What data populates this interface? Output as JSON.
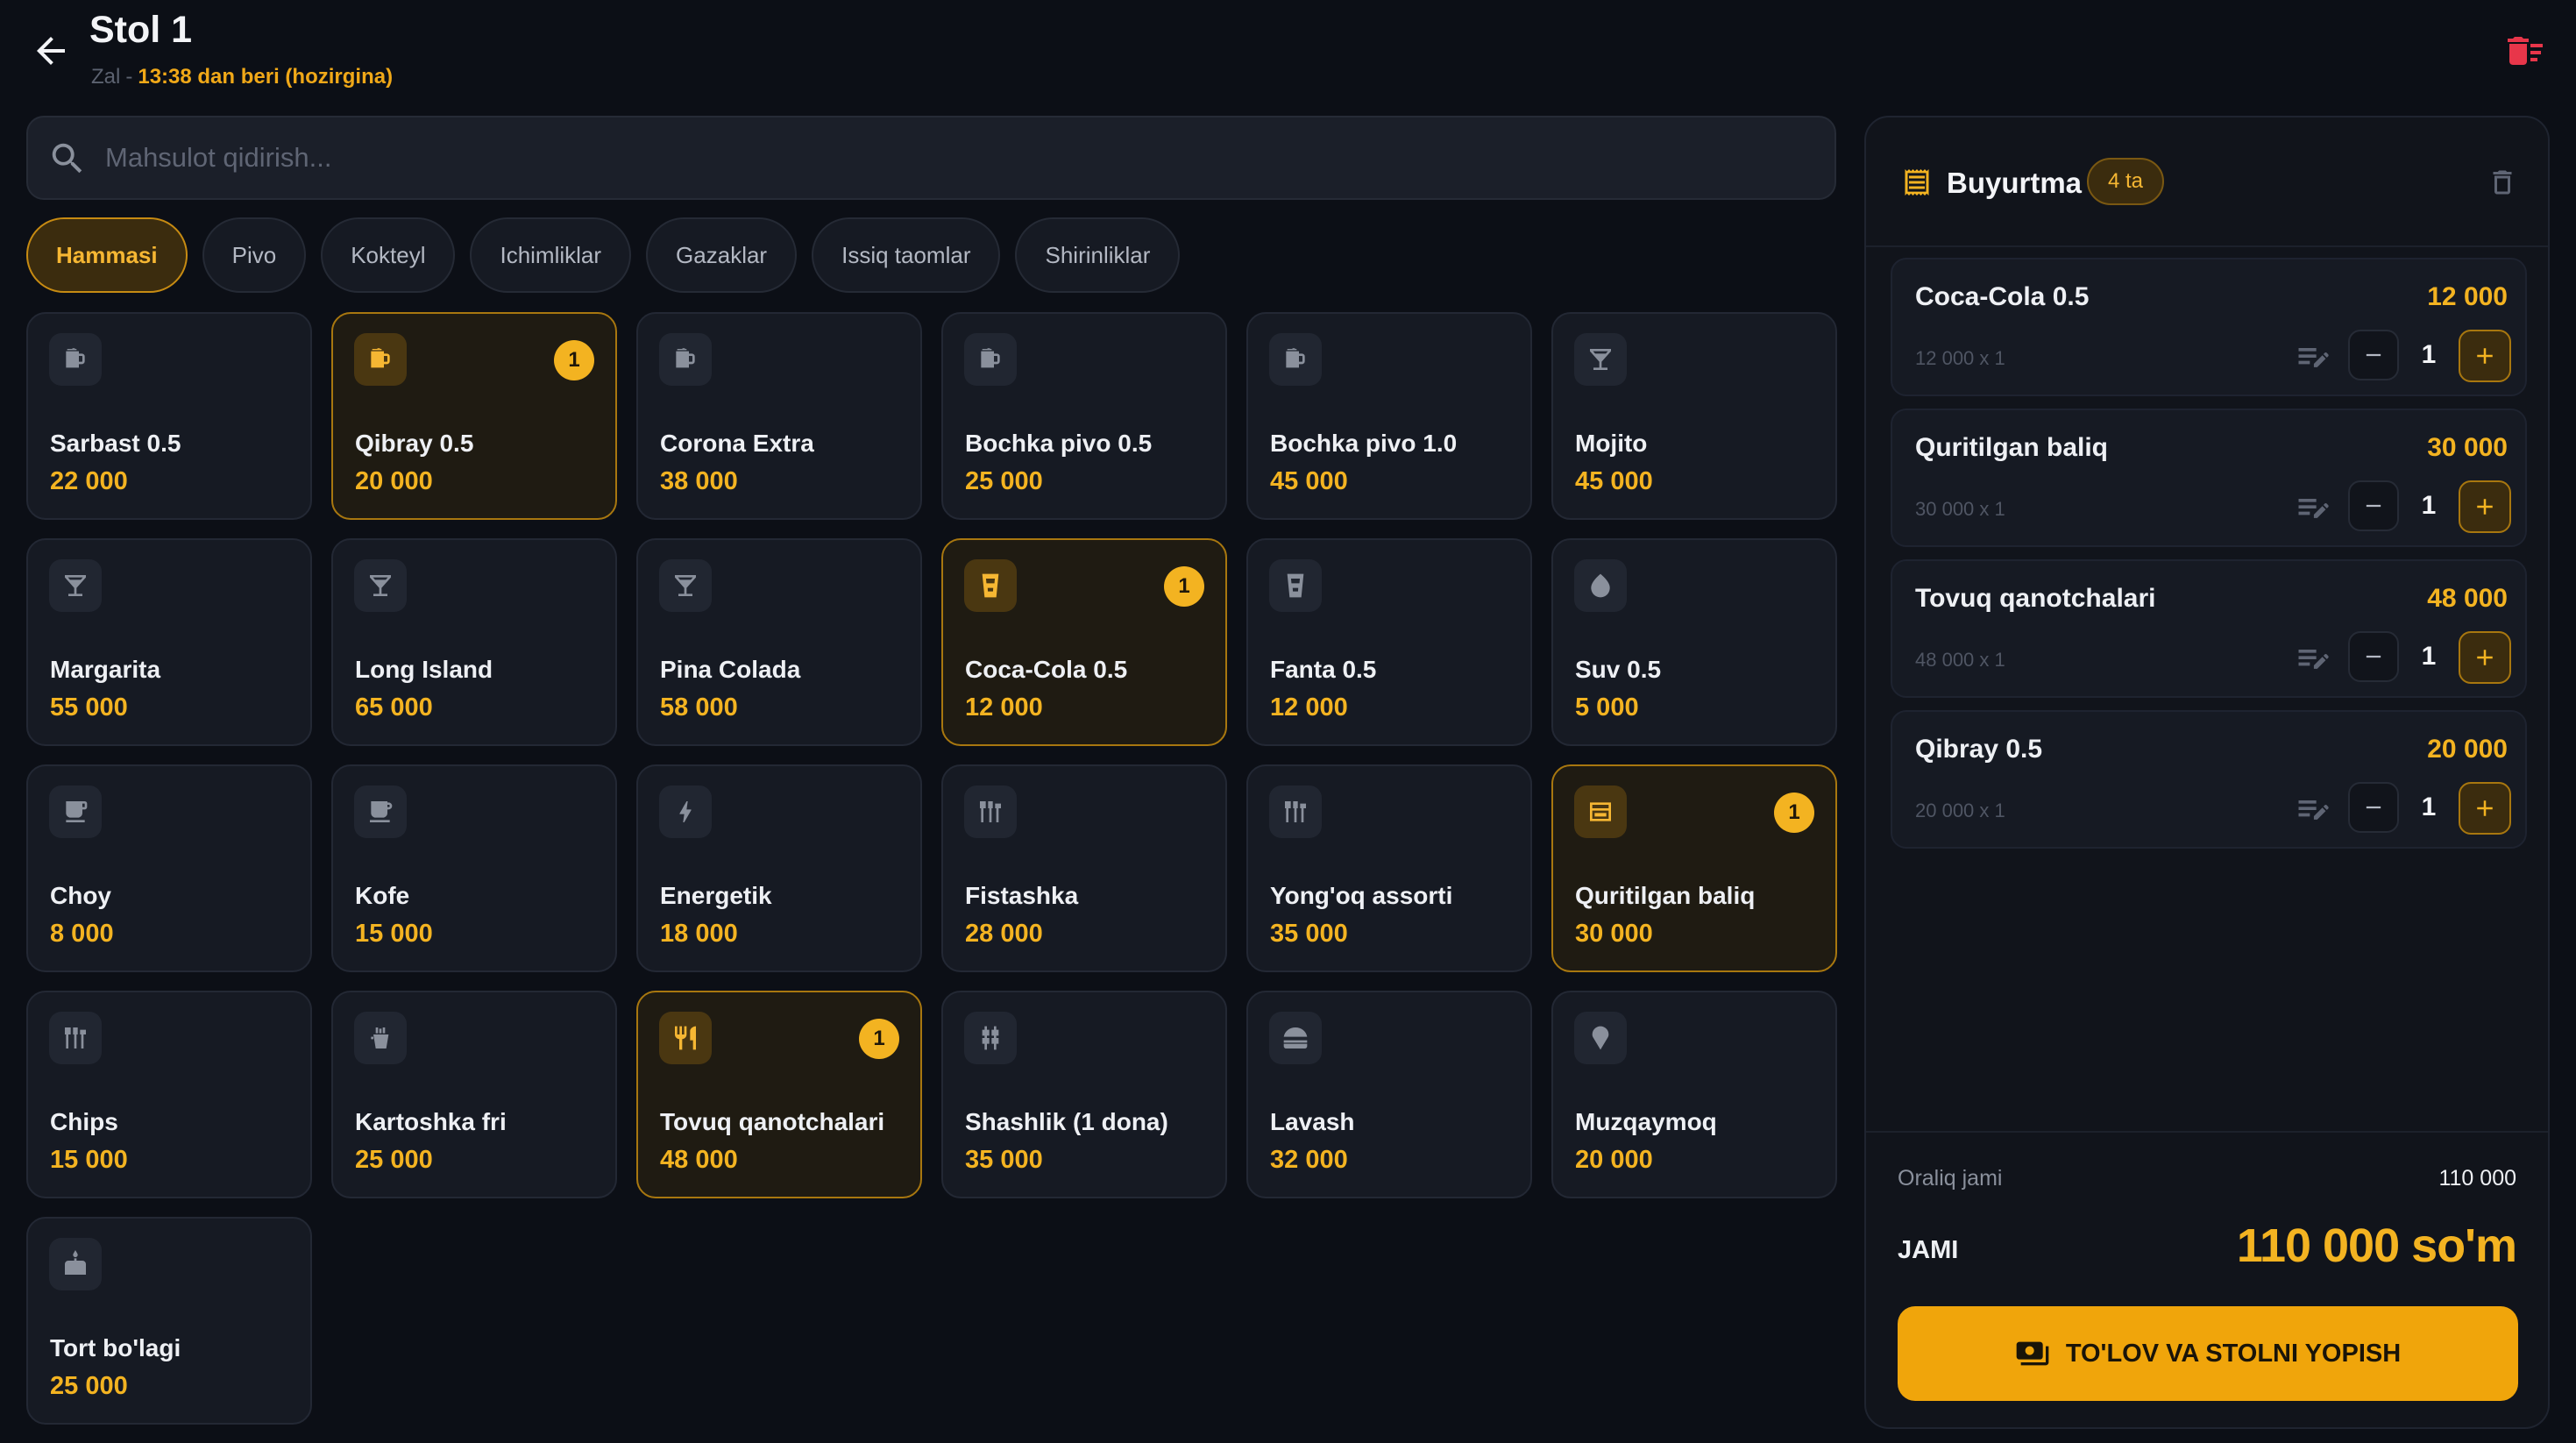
{
  "header": {
    "title": "Stol 1",
    "zone": "Zal",
    "separator": "-",
    "since": "13:38 dan beri (hozirgina)"
  },
  "search": {
    "placeholder": "Mahsulot qidirish..."
  },
  "categories": [
    {
      "label": "Hammasi",
      "active": true
    },
    {
      "label": "Pivo",
      "active": false
    },
    {
      "label": "Kokteyl",
      "active": false
    },
    {
      "label": "Ichimliklar",
      "active": false
    },
    {
      "label": "Gazaklar",
      "active": false
    },
    {
      "label": "Issiq taomlar",
      "active": false
    },
    {
      "label": "Shirinliklar",
      "active": false
    }
  ],
  "products": [
    {
      "name": "Sarbast 0.5",
      "price": "22 000",
      "icon": "beer-icon",
      "qty": ""
    },
    {
      "name": "Qibray 0.5",
      "price": "20 000",
      "icon": "beer-icon",
      "qty": "1"
    },
    {
      "name": "Corona Extra",
      "price": "38 000",
      "icon": "beer-icon",
      "qty": ""
    },
    {
      "name": "Bochka pivo 0.5",
      "price": "25 000",
      "icon": "beer-icon",
      "qty": ""
    },
    {
      "name": "Bochka pivo 1.0",
      "price": "45 000",
      "icon": "beer-icon",
      "qty": ""
    },
    {
      "name": "Mojito",
      "price": "45 000",
      "icon": "cocktail-icon",
      "qty": ""
    },
    {
      "name": "Margarita",
      "price": "55 000",
      "icon": "cocktail-icon",
      "qty": ""
    },
    {
      "name": "Long Island",
      "price": "65 000",
      "icon": "cocktail-icon",
      "qty": ""
    },
    {
      "name": "Pina Colada",
      "price": "58 000",
      "icon": "cocktail-icon",
      "qty": ""
    },
    {
      "name": "Coca-Cola 0.5",
      "price": "12 000",
      "icon": "cup-icon",
      "qty": "1"
    },
    {
      "name": "Fanta 0.5",
      "price": "12 000",
      "icon": "cup-icon",
      "qty": ""
    },
    {
      "name": "Suv 0.5",
      "price": "5 000",
      "icon": "water-drop-icon",
      "qty": ""
    },
    {
      "name": "Choy",
      "price": "8 000",
      "icon": "tea-icon",
      "qty": ""
    },
    {
      "name": "Kofe",
      "price": "15 000",
      "icon": "coffee-icon",
      "qty": ""
    },
    {
      "name": "Energetik",
      "price": "18 000",
      "icon": "bolt-icon",
      "qty": ""
    },
    {
      "name": "Fistashka",
      "price": "28 000",
      "icon": "snack-icon",
      "qty": ""
    },
    {
      "name": "Yong'oq assorti",
      "price": "35 000",
      "icon": "snack-icon",
      "qty": ""
    },
    {
      "name": "Quritilgan baliq",
      "price": "30 000",
      "icon": "fish-box-icon",
      "qty": "1"
    },
    {
      "name": "Chips",
      "price": "15 000",
      "icon": "snack-icon",
      "qty": ""
    },
    {
      "name": "Kartoshka fri",
      "price": "25 000",
      "icon": "fries-icon",
      "qty": ""
    },
    {
      "name": "Tovuq qanotchalari",
      "price": "48 000",
      "icon": "fork-knife-icon",
      "qty": "1"
    },
    {
      "name": "Shashlik (1 dona)",
      "price": "35 000",
      "icon": "kebab-icon",
      "qty": ""
    },
    {
      "name": "Lavash",
      "price": "32 000",
      "icon": "burger-icon",
      "qty": ""
    },
    {
      "name": "Muzqaymoq",
      "price": "20 000",
      "icon": "ice-cream-icon",
      "qty": ""
    },
    {
      "name": "Tort bo'lagi",
      "price": "25 000",
      "icon": "cake-icon",
      "qty": ""
    }
  ],
  "order": {
    "title": "Buyurtma",
    "count_badge": "4 ta",
    "items": [
      {
        "name": "Coca-Cola 0.5",
        "total": "12 000",
        "calc": "12 000 x 1",
        "qty": "1"
      },
      {
        "name": "Quritilgan baliq",
        "total": "30 000",
        "calc": "30 000 x 1",
        "qty": "1"
      },
      {
        "name": "Tovuq qanotchalari",
        "total": "48 000",
        "calc": "48 000 x 1",
        "qty": "1"
      },
      {
        "name": "Qibray 0.5",
        "total": "20 000",
        "calc": "20 000 x 1",
        "qty": "1"
      }
    ],
    "subtotal_label": "Oraliq jami",
    "subtotal_value": "110 000",
    "total_label": "JAMI",
    "total_value": "110 000 so'm",
    "pay_button": "TO'LOV VA STOLNI YOPISH"
  },
  "colors": {
    "accent": "#f3b321",
    "background": "#0c0f16",
    "card": "#161a23",
    "danger": "#e8364a"
  }
}
